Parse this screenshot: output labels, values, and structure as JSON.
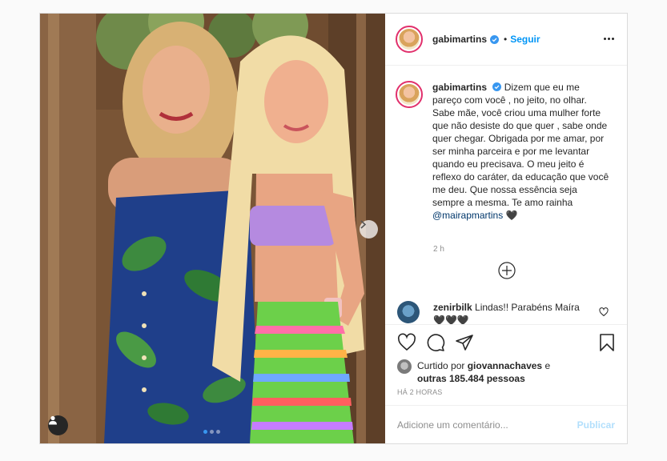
{
  "post": {
    "author": "gabimartins",
    "follow_label": "Seguir",
    "bullet": "•",
    "caption_text": "Dizem que eu me pareço com você , no jeito, no olhar. Sabe mãe, você criou uma mulher forte que não desiste do que quer , sabe onde quer chegar. Obrigada por me amar, por ser minha parceira e por me levantar quando eu precisava. O meu jeito é reflexo do caráter, da educação que você me deu. Que nossa essência seja sempre a mesma. Te amo rainha",
    "mention": "@mairapmartins",
    "heart_emoji": "🖤",
    "time_ago": "2 h",
    "carousel": {
      "count": 3,
      "active_index": 0
    }
  },
  "comments": [
    {
      "username": "zenirbilk",
      "text": "Lindas!! Parabéns Maíra 🖤🖤🖤"
    }
  ],
  "likes": {
    "prefix": "Curtido por",
    "first_user": "giovannachaves",
    "conjunction": "e",
    "others": "outras 185.484 pessoas"
  },
  "timestamp": "HÁ 2 HORAS",
  "comment_input": {
    "placeholder": "Adicione um comentário...",
    "publish_label": "Publicar"
  },
  "icons": {
    "verified": "verified-badge-icon",
    "more": "more-options-icon",
    "load_more": "plus-circle-icon",
    "like": "heart-icon",
    "comment": "comment-bubble-icon",
    "share": "paper-plane-icon",
    "save": "bookmark-icon",
    "next": "chevron-right-icon",
    "tag": "user-tag-icon"
  },
  "colors": {
    "accent": "#0095f6",
    "verified": "#3897f0",
    "mention": "#00376b",
    "muted": "#8e8e8e",
    "publish_disabled": "#b2dffc"
  }
}
